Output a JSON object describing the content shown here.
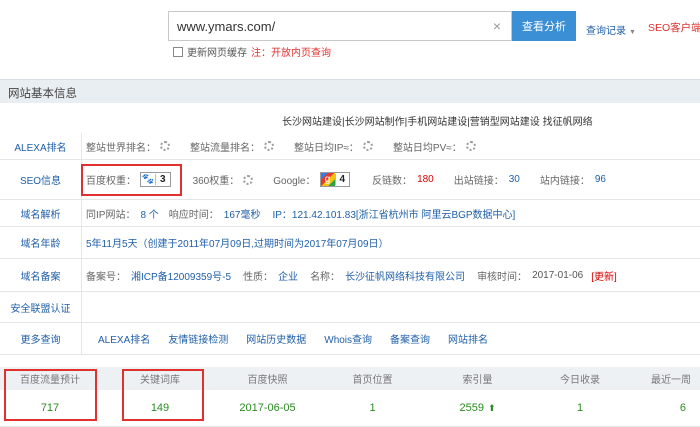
{
  "search": {
    "value": "www.ymars.com/",
    "clear_icon": "×",
    "button": "查看分析",
    "history": "查询记录",
    "client_link": "SEO客户端下"
  },
  "cache": {
    "label": "更新网页缓存",
    "note": "注：开放内页查询"
  },
  "panel": {
    "title": "网站基本信息",
    "banner": "长沙网站建设|长沙网站制作|手机网站建设|营销型网站建设 找征帆网络"
  },
  "rows": {
    "alexa": {
      "label": "ALEXA排名",
      "items": [
        "整站世界排名：",
        "整站流量排名：",
        "整站日均IP≈：",
        "整站日均PV≈："
      ]
    },
    "seo": {
      "label": "SEO信息",
      "baidu_label": "百度权重：",
      "baidu_value": "3",
      "w360_label": "360权重：",
      "google_label": "Google：",
      "google_value": "4",
      "backlinks_label": "反链数：",
      "backlinks_value": "180",
      "outlinks_label": "出站链接：",
      "outlinks_value": "30",
      "inlinks_label": "站内链接：",
      "inlinks_value": "96"
    },
    "domain": {
      "label": "域名解析",
      "sameip_label": "同IP网站：",
      "sameip_value": "8 个",
      "resp_label": "响应时间：",
      "resp_value": "167毫秒",
      "ip_text": "IP：121.42.101.83[浙江省杭州市 阿里云BGP数据中心]"
    },
    "age": {
      "label": "域名年龄",
      "text": "5年11月5天（创建于2011年07月09日,过期时间为2017年07月09日）"
    },
    "icp": {
      "label": "域名备案",
      "no_label": "备案号：",
      "no_value": "湘ICP备12009359号-5",
      "nature_label": "性质：",
      "nature_value": "企业",
      "name_label": "名称：",
      "name_value": "长沙征帆网络科技有限公司",
      "time_label": "审核时间：",
      "time_value": "2017-01-06",
      "update": "[更新]"
    },
    "security": {
      "label": "安全联盟认证"
    },
    "more": {
      "label": "更多查询",
      "links": [
        "ALEXA排名",
        "友情链接检测",
        "网站历史数据",
        "Whois查询",
        "备案查询",
        "网站排名"
      ]
    }
  },
  "stats": {
    "headers": [
      "百度流量预计",
      "关键词库",
      "百度快照",
      "首页位置",
      "索引量",
      "今日收录",
      "最近一周"
    ],
    "values": [
      "717",
      "149",
      "2017-06-05",
      "1",
      "2559",
      "1",
      "6"
    ],
    "index_trend_icon": "⬆"
  },
  "colors": {
    "accent_blue": "#3a8fd5",
    "link_blue": "#1f5fa8",
    "highlight_red": "#e0302f",
    "value_green": "#2a8a1f"
  }
}
